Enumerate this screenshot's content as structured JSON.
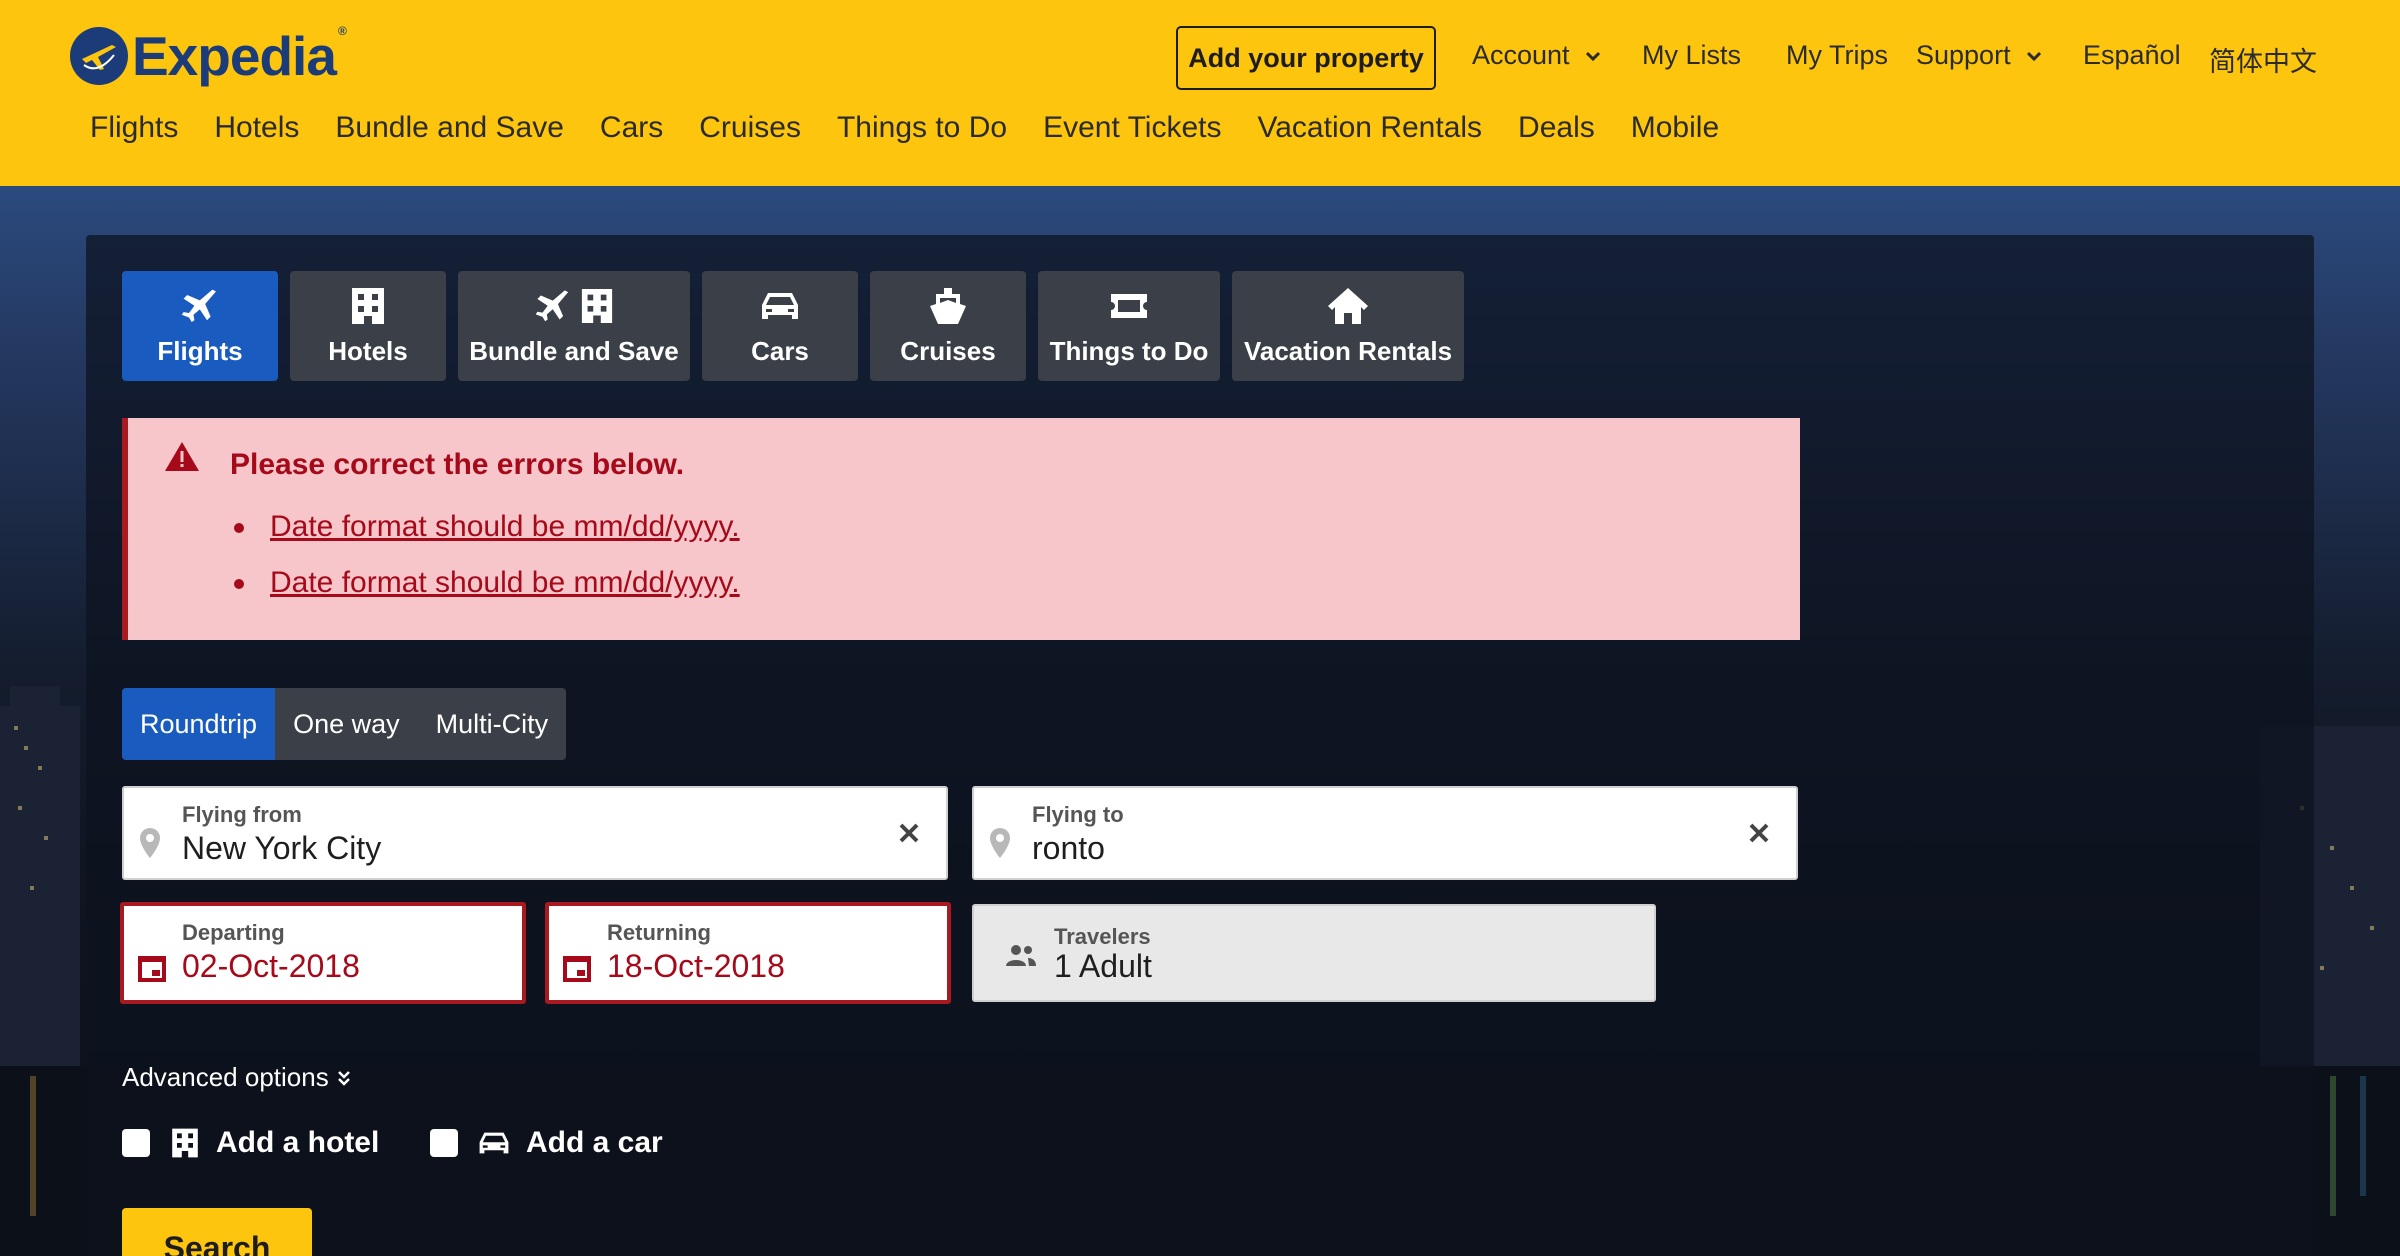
{
  "brand": {
    "name": "Expedia",
    "registered": "®"
  },
  "header": {
    "add_property": "Add your property",
    "account": "Account",
    "my_lists": "My Lists",
    "my_trips": "My Trips",
    "support": "Support",
    "espanol": "Español",
    "chinese": "简体中文"
  },
  "mainnav": [
    "Flights",
    "Hotels",
    "Bundle and Save",
    "Cars",
    "Cruises",
    "Things to Do",
    "Event Tickets",
    "Vacation Rentals",
    "Deals",
    "Mobile"
  ],
  "tabs": [
    {
      "label": "Flights",
      "icon": "plane-icon",
      "active": true
    },
    {
      "label": "Hotels",
      "icon": "building-icon"
    },
    {
      "label": "Bundle and Save",
      "icon": "plane-building-icon"
    },
    {
      "label": "Cars",
      "icon": "car-icon"
    },
    {
      "label": "Cruises",
      "icon": "ship-icon"
    },
    {
      "label": "Things to Do",
      "icon": "ticket-icon"
    },
    {
      "label": "Vacation Rentals",
      "icon": "house-icon"
    }
  ],
  "error": {
    "title": "Please correct the errors below.",
    "items": [
      "Date format should be mm/dd/yyyy.",
      "Date format should be mm/dd/yyyy."
    ]
  },
  "triptype": {
    "roundtrip": "Roundtrip",
    "oneway": "One way",
    "multicity": "Multi-City"
  },
  "form": {
    "from_label": "Flying from",
    "from_value": "New York City",
    "to_label": "Flying to",
    "to_value": "ronto",
    "depart_label": "Departing",
    "depart_value": "02-Oct-2018",
    "return_label": "Returning",
    "return_value": "18-Oct-2018",
    "travelers_label": "Travelers",
    "travelers_value": "1 Adult"
  },
  "advanced": "Advanced options",
  "add_hotel": "Add a hotel",
  "add_car": "Add a car",
  "search": "Search",
  "colors": {
    "header": "#fdc50e",
    "brand_blue": "#1b3c78",
    "active_blue": "#1a5bbf",
    "error_red": "#a5091a",
    "error_bg": "#f7c6ca"
  }
}
